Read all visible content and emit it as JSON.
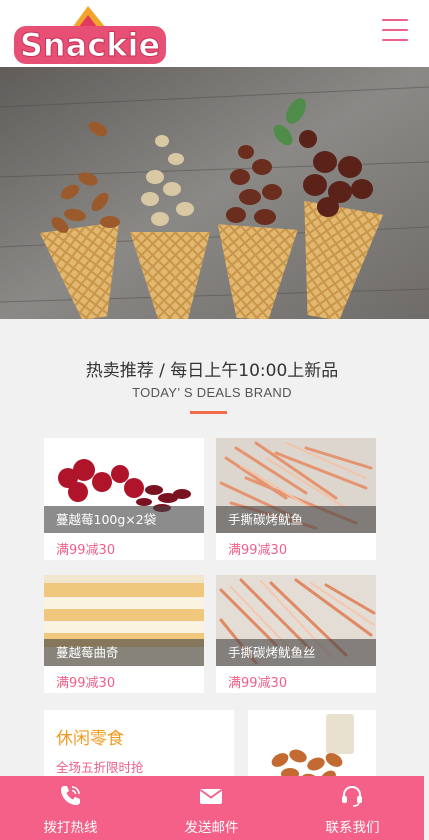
{
  "brand": {
    "logo_text": "Snackie"
  },
  "section": {
    "title": "热卖推荐 / 每日上午10:00上新品",
    "subtitle": "TODAY’ S DEALS BRAND"
  },
  "products": [
    {
      "name": "蔓越莓100g×2袋",
      "promo": "满99减30"
    },
    {
      "name": "手撕碳烤鱿鱼",
      "promo": "满99减30"
    },
    {
      "name": "蔓越莓曲奇",
      "promo": "满99减30"
    },
    {
      "name": "手撕碳烤鱿鱼丝",
      "promo": "满99减30"
    }
  ],
  "promo_card": {
    "title": "休闲零食",
    "subtitle": "全场五折限时抢"
  },
  "bottom_bar": [
    {
      "label": "拨打热线",
      "icon": "phone-icon"
    },
    {
      "label": "发送邮件",
      "icon": "mail-icon"
    },
    {
      "label": "联系我们",
      "icon": "headset-icon"
    }
  ],
  "colors": {
    "accent": "#f46088",
    "promo_title": "#f39a1e",
    "underline": "#f26c4a"
  }
}
